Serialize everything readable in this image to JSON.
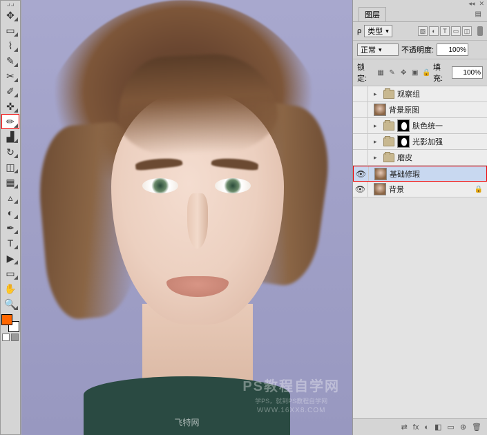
{
  "panels": {
    "layers_title": "图层"
  },
  "filter": {
    "label": "类型"
  },
  "blend": {
    "mode": "正常",
    "opacity_label": "不透明度:",
    "opacity_value": "100%",
    "fill_label": "填充:",
    "fill_value": "100%"
  },
  "lock": {
    "label": "锁定:"
  },
  "layers": [
    {
      "visible": false,
      "type": "folder",
      "indent": 0,
      "name": "观察组"
    },
    {
      "visible": false,
      "type": "image",
      "indent": 0,
      "name": "背景原图"
    },
    {
      "visible": false,
      "type": "folder",
      "indent": 0,
      "mask": true,
      "name": "肤色统一"
    },
    {
      "visible": false,
      "type": "folder",
      "indent": 0,
      "mask": true,
      "name": "光影加强"
    },
    {
      "visible": false,
      "type": "folder",
      "indent": 0,
      "name": "磨皮"
    },
    {
      "visible": true,
      "type": "image",
      "indent": 0,
      "name": "基础修瑕",
      "selected": true
    },
    {
      "visible": true,
      "type": "image",
      "indent": 0,
      "name": "背景",
      "locked": true
    }
  ],
  "watermark": {
    "bottom": "飞特网",
    "title": "PS教程自学网",
    "sub": "学PS，就到PS教程自学网",
    "url": "WWW.16XX8.COM"
  },
  "footer_icons": [
    "⇄",
    "fx",
    "◐",
    "◧",
    "▭",
    "⊕",
    "🗑"
  ]
}
